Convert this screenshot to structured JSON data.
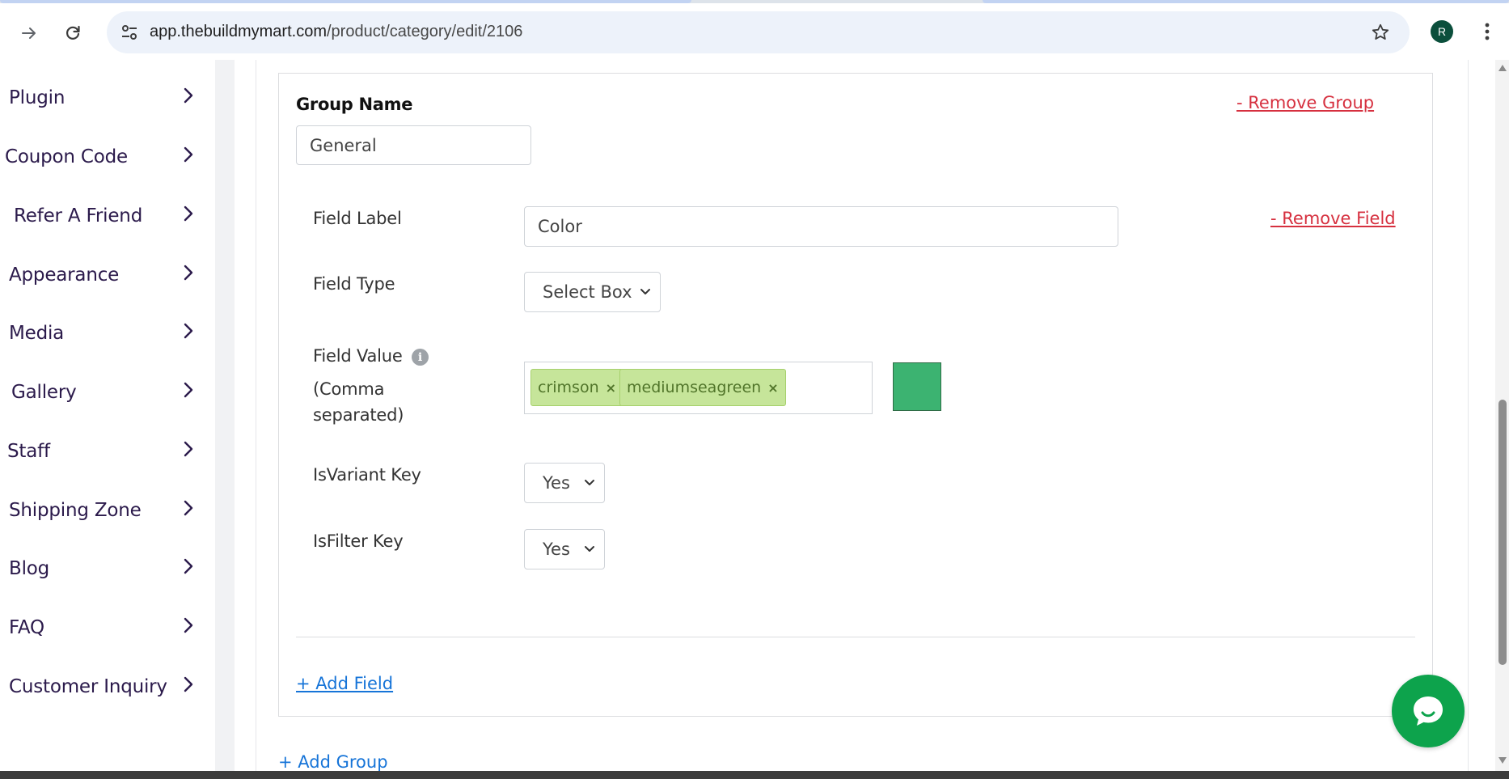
{
  "browser": {
    "url_host": "app.thebuildmymart.com",
    "url_path": "/product/category/edit/2106",
    "profile_initial": "R"
  },
  "sidebar": {
    "items": [
      {
        "label": "Plugin"
      },
      {
        "label": "Coupon Code"
      },
      {
        "label": "Refer A Friend"
      },
      {
        "label": "Appearance"
      },
      {
        "label": "Media"
      },
      {
        "label": "Gallery"
      },
      {
        "label": "Staff"
      },
      {
        "label": "Shipping Zone"
      },
      {
        "label": "Blog"
      },
      {
        "label": "FAQ"
      },
      {
        "label": "Customer Inquiry"
      }
    ]
  },
  "group": {
    "name_label": "Group Name",
    "name_value": "General",
    "remove_label": "- Remove Group",
    "field": {
      "remove_label": "- Remove Field",
      "label_caption": "Field Label",
      "label_value": "Color",
      "type_caption": "Field Type",
      "type_value": "Select Box",
      "value_caption": "Field Value",
      "value_caption_2": "(Comma",
      "value_caption_3": "separated)",
      "tags": [
        "crimson",
        "mediumseagreen"
      ],
      "tag_remove_glyph": "×",
      "swatch_color": "#3cb371",
      "variant_caption": "IsVariant Key",
      "variant_value": "Yes",
      "filter_caption": "IsFilter Key",
      "filter_value": "Yes"
    },
    "add_field_label": "+ Add Field"
  },
  "add_group_label": "+ Add Group",
  "colors": {
    "link_red": "#d6303f",
    "link_blue": "#1674d8",
    "tag_bg": "#c6e59a",
    "chat_green": "#0da34c"
  }
}
